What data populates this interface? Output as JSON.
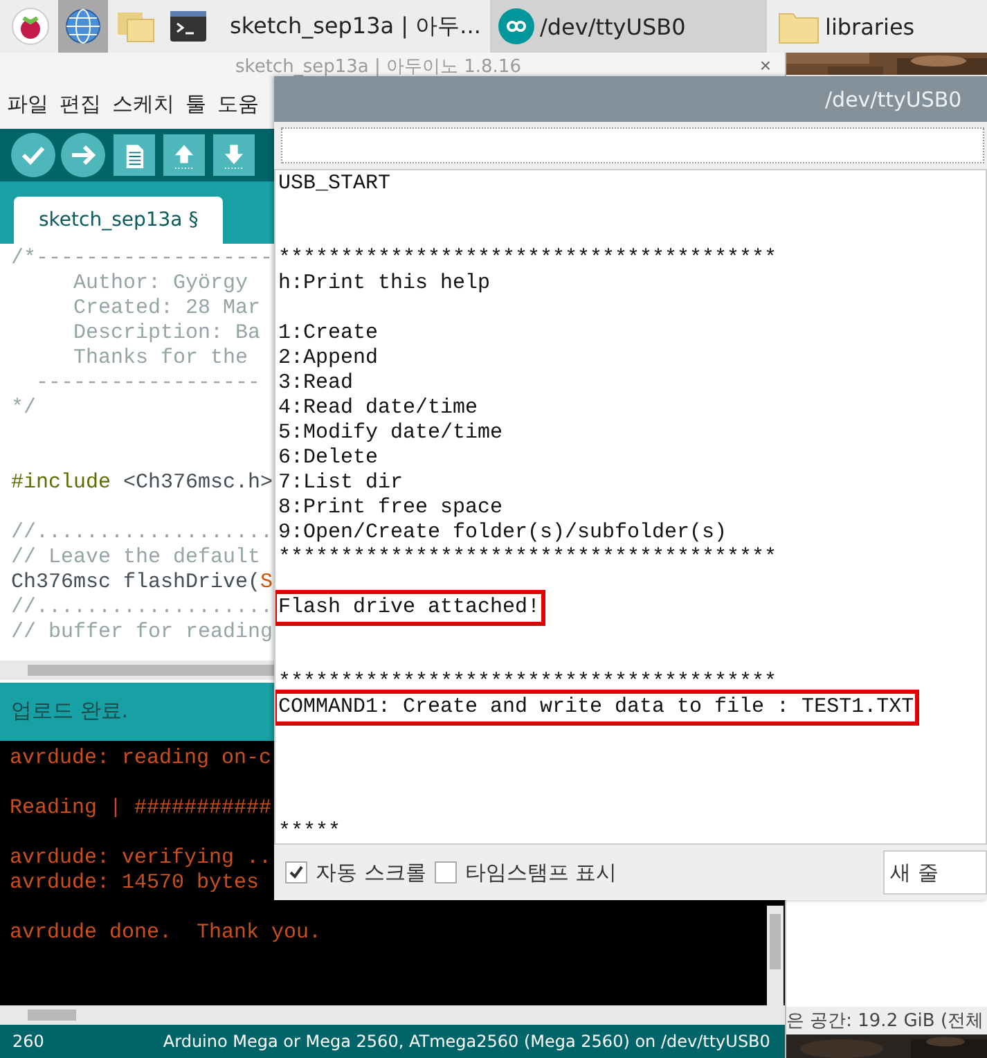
{
  "taskbar": {
    "launchers": [
      {
        "kind": "raspberry",
        "selected": false
      },
      {
        "kind": "globe",
        "selected": true
      },
      {
        "kind": "folders",
        "selected": false
      },
      {
        "kind": "terminal",
        "selected": false
      }
    ],
    "tasks": [
      {
        "kind": "arduino",
        "label": "sketch_sep13a | 아두...",
        "selected": false
      },
      {
        "kind": "arduino",
        "label": "/dev/ttyUSB0",
        "selected": true
      },
      {
        "kind": "folder",
        "label": "libraries",
        "selected": false
      }
    ]
  },
  "ide": {
    "title": "sketch_sep13a | 아두이노 1.8.16",
    "close": "×",
    "menu": [
      "파일",
      "편집",
      "스케치",
      "툴",
      "도움"
    ],
    "toolbar": [
      {
        "kind": "verify"
      },
      {
        "kind": "upload"
      },
      {
        "kind": "new"
      },
      {
        "kind": "open"
      },
      {
        "kind": "save"
      }
    ],
    "tab": "sketch_sep13a §",
    "code": [
      {
        "parts": [
          {
            "kind": "comment",
            "text": "/*-------------------"
          }
        ]
      },
      {
        "parts": [
          {
            "kind": "comment",
            "text": "     Author: György"
          }
        ]
      },
      {
        "parts": [
          {
            "kind": "comment",
            "text": "     Created: 28 Mar"
          }
        ]
      },
      {
        "parts": [
          {
            "kind": "comment",
            "text": "     Description: Ba"
          }
        ]
      },
      {
        "parts": [
          {
            "kind": "comment",
            "text": "     Thanks for the"
          }
        ]
      },
      {
        "parts": [
          {
            "kind": "comment",
            "text": "  ------------------"
          }
        ]
      },
      {
        "parts": [
          {
            "kind": "comment",
            "text": "*/"
          }
        ]
      },
      {
        "kind": "blank"
      },
      {
        "kind": "blank"
      },
      {
        "parts": [
          {
            "kind": "directive",
            "text": "#include"
          },
          {
            "kind": "plain",
            "text": " <Ch376msc.h>"
          }
        ]
      },
      {
        "kind": "blank"
      },
      {
        "parts": [
          {
            "kind": "comment",
            "text": "//..................."
          }
        ]
      },
      {
        "parts": [
          {
            "kind": "comment",
            "text": "// Leave the default"
          }
        ]
      },
      {
        "parts": [
          {
            "kind": "plain",
            "text": "Ch376msc flashDrive("
          },
          {
            "kind": "keyword",
            "text": "S"
          }
        ]
      },
      {
        "parts": [
          {
            "kind": "comment",
            "text": "//..................."
          }
        ]
      },
      {
        "parts": [
          {
            "kind": "comment",
            "text": "// buffer for reading"
          }
        ]
      }
    ],
    "message": "업로드 완료.",
    "console": [
      {
        "kind": "text",
        "text": "avrdude: reading on-c"
      },
      {
        "kind": "blank"
      },
      {
        "kind": "text",
        "text": "Reading | ###########"
      },
      {
        "kind": "blank"
      },
      {
        "kind": "text",
        "text": "avrdude: verifying .."
      },
      {
        "kind": "text",
        "text": "avrdude: 14570 bytes"
      },
      {
        "kind": "blank"
      },
      {
        "kind": "text",
        "text": "avrdude done.  Thank you."
      }
    ],
    "status": {
      "line": "260",
      "board": "Arduino Mega or Mega 2560, ATmega2560 (Mega 2560) on /dev/ttyUSB0"
    }
  },
  "serial": {
    "title": "/dev/ttyUSB0",
    "output": [
      {
        "kind": "text",
        "text": "USB_START",
        "highlighted": false
      },
      {
        "kind": "blank"
      },
      {
        "kind": "blank"
      },
      {
        "kind": "text",
        "text": "****************************************",
        "highlighted": false
      },
      {
        "kind": "text",
        "text": "h:Print this help",
        "highlighted": false
      },
      {
        "kind": "blank"
      },
      {
        "kind": "text",
        "text": "1:Create",
        "highlighted": false
      },
      {
        "kind": "text",
        "text": "2:Append",
        "highlighted": false
      },
      {
        "kind": "text",
        "text": "3:Read",
        "highlighted": false
      },
      {
        "kind": "text",
        "text": "4:Read date/time",
        "highlighted": false
      },
      {
        "kind": "text",
        "text": "5:Modify date/time",
        "highlighted": false
      },
      {
        "kind": "text",
        "text": "6:Delete",
        "highlighted": false
      },
      {
        "kind": "text",
        "text": "7:List dir",
        "highlighted": false
      },
      {
        "kind": "text",
        "text": "8:Print free space",
        "highlighted": false
      },
      {
        "kind": "text",
        "text": "9:Open/Create folder(s)/subfolder(s)",
        "highlighted": false
      },
      {
        "kind": "text",
        "text": "****************************************",
        "highlighted": false
      },
      {
        "kind": "blank"
      },
      {
        "kind": "text",
        "text": "Flash drive attached!",
        "highlighted": true
      },
      {
        "kind": "blank"
      },
      {
        "kind": "blank"
      },
      {
        "kind": "text",
        "text": "****************************************",
        "highlighted": false
      },
      {
        "kind": "text",
        "text": "COMMAND1: Create and write data to file : TEST1.TXT",
        "highlighted": true
      },
      {
        "kind": "blank"
      },
      {
        "kind": "blank"
      },
      {
        "kind": "blank"
      },
      {
        "kind": "blank"
      },
      {
        "kind": "text",
        "text": "*****",
        "highlighted": false
      }
    ],
    "autoscroll": {
      "label": "자동 스크롤",
      "checked": true
    },
    "timestamp": {
      "label": "타임스탬프 표시",
      "checked": false
    },
    "line_ending": "새 줄"
  },
  "files": {
    "free_space": "은 공간: 19.2 GiB (전체"
  }
}
